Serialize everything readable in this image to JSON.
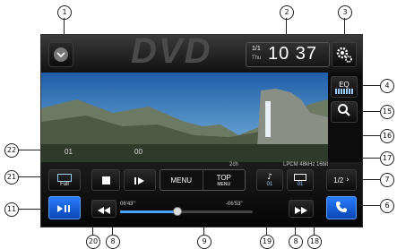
{
  "app": {
    "background_label": "DVD"
  },
  "status": {
    "date": "1/1",
    "weekday": "Thu",
    "time": "10 37"
  },
  "side_controls": {
    "eq_label": "EQ"
  },
  "video": {
    "left_text": "01",
    "right_text": "00"
  },
  "top_menu_strip": {
    "left": "2ch",
    "right": "LPCM 48kHz 16bit"
  },
  "controls": {
    "menu_label": "MENU",
    "top_menu_label_top": "TOP",
    "top_menu_label_bottom": "MENU",
    "screen_mode_label": "Full",
    "subtitle_value": "01",
    "angle_value": "01",
    "page_label": "1/2",
    "elapsed_time": "06'43\"",
    "remaining_time": "-06'53\""
  },
  "progress": {
    "fraction": 0.43
  },
  "callouts": [
    "1",
    "2",
    "3",
    "4",
    "15",
    "16",
    "17",
    "7",
    "6",
    "18",
    "8",
    "19",
    "9",
    "8",
    "20",
    "11",
    "21",
    "22"
  ],
  "colors": {
    "accent": "#1f78ff",
    "screen_bg": "#111111",
    "button_bg": "#1b1b1b",
    "sky": "#2f86c8"
  }
}
